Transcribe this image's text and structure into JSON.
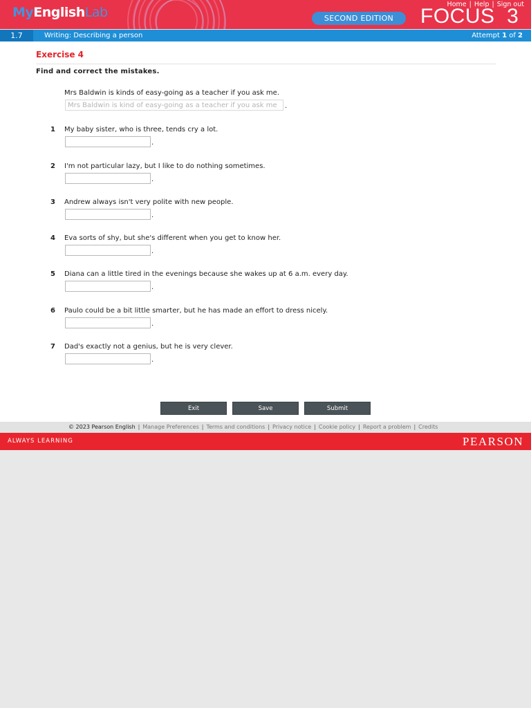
{
  "header": {
    "brand_my": "My",
    "brand_english": "English",
    "brand_lab": "Lab",
    "links": [
      "Home",
      "Help",
      "Sign out"
    ],
    "edition": "SECOND EDITION",
    "product": "FOCUS  3"
  },
  "unitbar": {
    "number": "1.7",
    "title": "Writing: Describing a person",
    "attempt_prefix": "Attempt ",
    "attempt_current": "1",
    "attempt_of": " of ",
    "attempt_total": "2"
  },
  "exercise": {
    "title": "Exercise 4",
    "instruction": "Find and correct the mistakes.",
    "example": {
      "sentence": "Mrs Baldwin is kinds of easy-going as a teacher if you ask me.",
      "answer": "Mrs Baldwin is kind of easy-going as a teacher if you ask me"
    },
    "items": [
      {
        "num": "1",
        "sentence": "My baby sister, who is three, tends cry a lot.",
        "value": ""
      },
      {
        "num": "2",
        "sentence": "I'm not particular lazy, but I like to do nothing sometimes.",
        "value": ""
      },
      {
        "num": "3",
        "sentence": "Andrew always isn't very polite with new people.",
        "value": ""
      },
      {
        "num": "4",
        "sentence": "Eva sorts of shy, but she's different when you get to know her.",
        "value": ""
      },
      {
        "num": "5",
        "sentence": "Diana can a little tired in the evenings because she wakes up at 6 a.m. every day.",
        "value": ""
      },
      {
        "num": "6",
        "sentence": "Paulo could be a bit little smarter, but he has made an effort to dress nicely.",
        "value": ""
      },
      {
        "num": "7",
        "sentence": "Dad's exactly not a genius, but he is very clever.",
        "value": ""
      }
    ],
    "period": "."
  },
  "buttons": {
    "exit": "Exit",
    "save": "Save",
    "submit": "Submit"
  },
  "footer": {
    "copyright": "© 2023 Pearson English",
    "links": [
      "Manage Preferences",
      "Terms and conditions",
      "Privacy notice",
      "Cookie policy",
      "Report a problem",
      "Credits"
    ]
  },
  "pearson_bar": {
    "tagline": "ALWAYS LEARNING",
    "logo": "PEARSON"
  },
  "colors": {
    "header_red": "#e8334a",
    "accent_blue": "#1e8ed6",
    "exercise_red": "#e2252b",
    "button_dark": "#4a5357"
  }
}
